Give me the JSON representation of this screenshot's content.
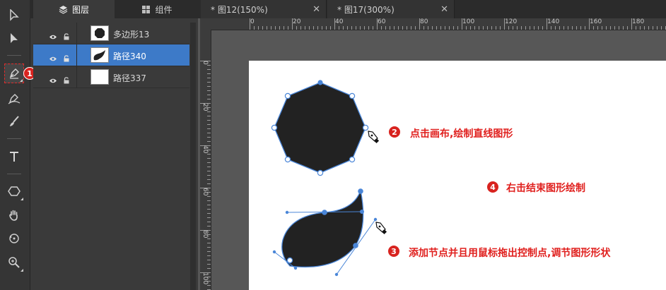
{
  "tabs": {
    "layers_tab": "图层",
    "components_tab": "组件",
    "doc1": "* 图12(150%)",
    "doc2": "* 图17(300%)",
    "close_symbol": "✕"
  },
  "layers": [
    {
      "name": "多边形13",
      "thumb": "octagon",
      "selected": false
    },
    {
      "name": "路径340",
      "thumb": "leaf",
      "selected": true
    },
    {
      "name": "路径337",
      "thumb": "blank",
      "selected": false
    }
  ],
  "tools": [
    "select-arrow",
    "direct-select-arrow",
    "pen",
    "curvature-pen",
    "brush",
    "text",
    "polygon",
    "hand",
    "rotate-view",
    "zoom"
  ],
  "ruler": {
    "top_labels": [
      "0",
      "20",
      "40",
      "60",
      "80",
      "100",
      "120",
      "140",
      "160",
      "180"
    ],
    "left_labels": [
      "0",
      "20",
      "40",
      "60",
      "80",
      "100"
    ]
  },
  "badges": {
    "b1": "1",
    "b2": "2",
    "b3": "3",
    "b4": "4"
  },
  "annotations": {
    "a2": "点击画布,绘制直线图形",
    "a3": "添加节点并且用鼠标拖出控制点,调节图形形状",
    "a4": "右击结束图形绘制"
  },
  "colors": {
    "accent_selected": "#3d7ac8",
    "annotation_red": "#e0201e",
    "shape_fill": "#222222",
    "path_blue": "#4a86d8"
  }
}
